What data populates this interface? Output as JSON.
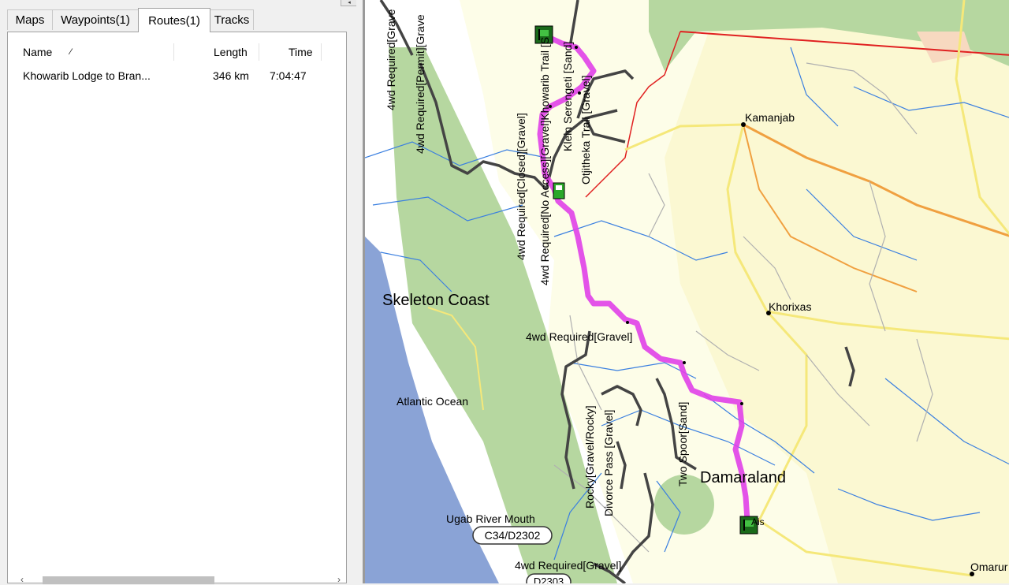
{
  "tabs": [
    {
      "label": "Maps"
    },
    {
      "label": "Waypoints(1)"
    },
    {
      "label": "Routes(1)"
    },
    {
      "label": "Tracks"
    }
  ],
  "routes_list": {
    "columns": {
      "name": "Name",
      "sort_indicator": "⁄",
      "length": "Length",
      "time": "Time"
    },
    "rows": [
      {
        "name": "Khowarib Lodge to Bran...",
        "length": "346 km",
        "time": "7:04:47"
      }
    ]
  },
  "map": {
    "labels": {
      "kamanjab": "Kamanjab",
      "khorixas": "Khorixas",
      "skeleton_coast": "Skeleton Coast",
      "atlantic_ocean": "Atlantic Ocean",
      "damaraland": "Damaraland",
      "ugab_river_mouth": "Ugab River Mouth",
      "c34_d2302": "C34/D2302",
      "d2303": "D2303",
      "omaruru": "Omarur",
      "road_4wd_gravel_1": "4wd Required[Gravel]",
      "road_4wd_gravel_2": "4wd Required[Gravel]",
      "road_4wd_gravel_left": "4wd Required[Grave",
      "road_4wd_permit": "4wd Required[Permit][Grave",
      "road_4wd_closed": "4wd Required[Closed][Gravel]",
      "road_4wd_noaccess": "4wd Required[No Access][Gravel]Khowarib Trail [S",
      "road_klein_serengeti": "Klein Serengeti [Sand]",
      "road_otjitheka": "Otjitheka Trail [Gravel]",
      "road_rocky": "Rocky[Gravel/Rocky]",
      "road_divorce_pass": "Divorce Pass [Gravel]",
      "road_two_spoor": "Two Spoor[Sand]",
      "end_marker_label": "Ais"
    },
    "colors": {
      "route": "#e040e8",
      "ocean": "#8aa3d6",
      "park": "#b6d7a0",
      "land": "#fdfde8",
      "road_orange": "#f0a040",
      "road_yellow": "#f5e87a",
      "river": "#3a7fe0",
      "track": "#444444"
    },
    "icons": [
      "start-flag-icon",
      "waypoint-fuel-icon",
      "end-flag-icon"
    ]
  }
}
